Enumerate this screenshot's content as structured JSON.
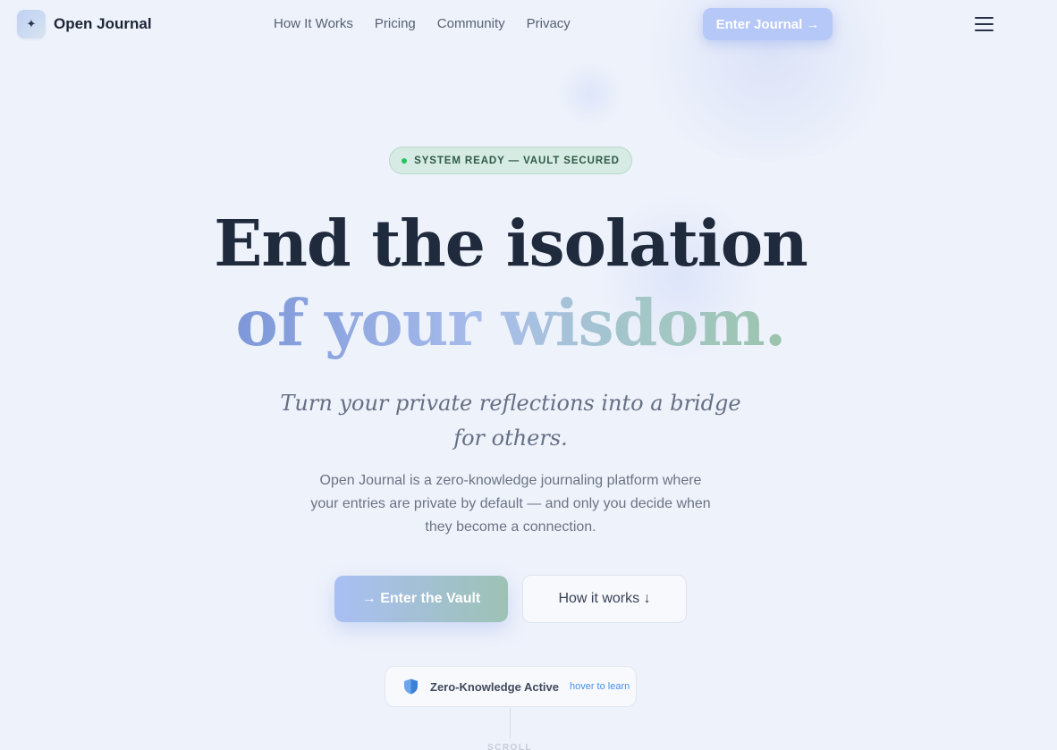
{
  "brand": {
    "name": "Open Journal",
    "logo_icon": "sparkle-icon",
    "logo_glyph": "✦"
  },
  "nav": {
    "links": [
      "How It Works",
      "Pricing",
      "Community",
      "Privacy"
    ],
    "cta_label": "Enter Journal →",
    "menu_icon": "hamburger-menu-icon"
  },
  "hero": {
    "badge": "SYSTEM READY — VAULT SECURED",
    "headline_line1": "End the isolation",
    "headline_line2": "of your wisdom.",
    "tagline": "Turn your private reflections into a bridge for others.",
    "description": "Open Journal is a zero-knowledge journaling platform where your entries are private by default — and only you decide when they become a connection.",
    "primary_button": "→ Enter the Vault",
    "secondary_button": "How it works ↓"
  },
  "zero_knowledge": {
    "icon": "shield-icon",
    "label": "Zero-Knowledge Active",
    "hint": "hover to learn"
  },
  "scroll": {
    "label": "SCROLL"
  },
  "colors": {
    "background": "#eef2fb",
    "accent": "#b6c8f7",
    "status": "#22c55e",
    "hint_link": "#4a90e2"
  }
}
